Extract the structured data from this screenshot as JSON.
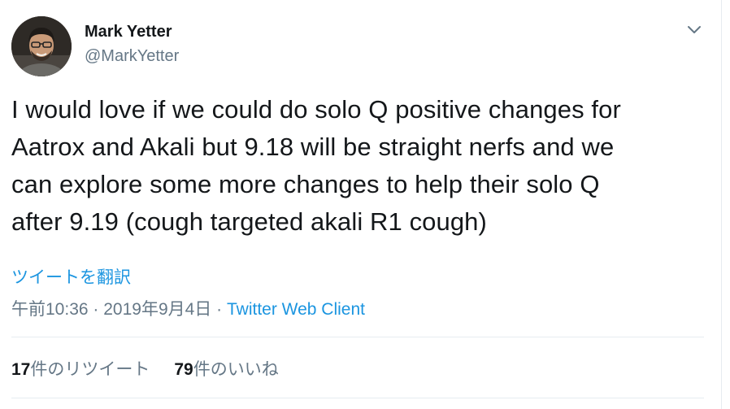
{
  "author": {
    "name": "Mark Yetter",
    "handle": "@MarkYetter",
    "avatar_icon": "profile-photo"
  },
  "tweet": {
    "lines": [
      "I would love if we could do solo Q positive changes for",
      "Aatrox and Akali but 9.18 will be straight nerfs and we",
      "can explore some more changes to help their solo Q",
      "after 9.19 (cough targeted akali R1 cough)"
    ],
    "translate_label": "ツイートを翻訳"
  },
  "meta": {
    "time": "午前10:36",
    "separator": " · ",
    "date": "2019年9月4日",
    "client": "Twitter Web Client"
  },
  "stats": {
    "retweet_count": "17",
    "retweet_label": "件のリツイート",
    "like_count": "79",
    "like_label": "件のいいね"
  },
  "icons": {
    "menu": "chevron-down-icon"
  },
  "colors": {
    "link": "#1b95e0",
    "muted": "#657786",
    "text": "#14171a",
    "divider": "#e6ecf0"
  }
}
